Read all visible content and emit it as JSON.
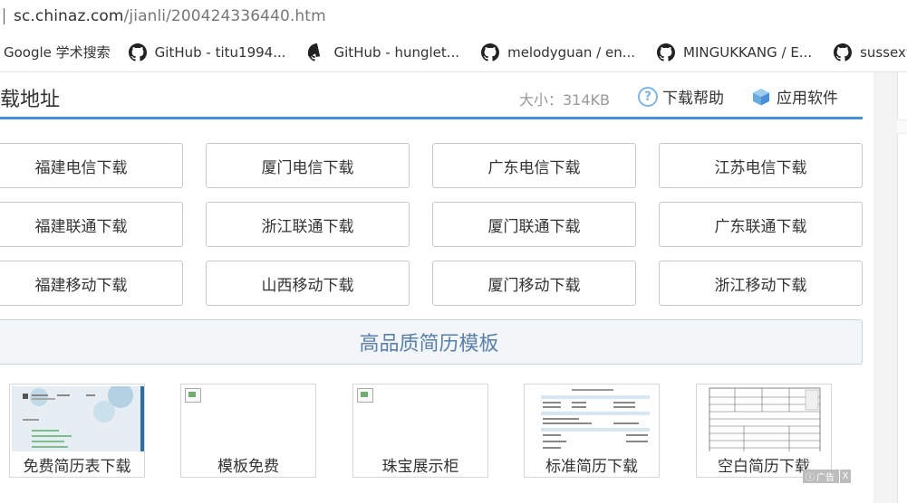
{
  "address_bar": {
    "url_host": "sc.chinaz.com",
    "url_path": "/jianli/200424336440.htm"
  },
  "bookmarks": [
    {
      "label": "Google 学术搜索",
      "icon": "none"
    },
    {
      "label": "GitHub - titu1994...",
      "icon": "github-icon"
    },
    {
      "label": "GitHub - hunglet...",
      "icon": "github-icon"
    },
    {
      "label": "melodyguan / en...",
      "icon": "github-icon"
    },
    {
      "label": "MINGUKKANG / E...",
      "icon": "github-icon"
    },
    {
      "label": "sussexwe",
      "icon": "github-icon"
    }
  ],
  "header": {
    "title": "载地址",
    "size": "大小：314KB",
    "help_label": "下载帮助",
    "apps_label": "应用软件"
  },
  "downloads": [
    [
      "福建电信下载",
      "厦门电信下载",
      "广东电信下载",
      "江苏电信下载"
    ],
    [
      "福建联通下载",
      "浙江联通下载",
      "厦门联通下载",
      "广东联通下载"
    ],
    [
      "福建移动下载",
      "山西移动下载",
      "厦门移动下载",
      "浙江移动下载"
    ]
  ],
  "banner": {
    "label": "高品质简历模板"
  },
  "thumbnails": [
    {
      "caption": "免费简历表下载"
    },
    {
      "caption": "模板免费"
    },
    {
      "caption": "珠宝展示柜"
    },
    {
      "caption": "标准简历下载"
    },
    {
      "caption": "空白简历下载"
    }
  ],
  "ad_badge": {
    "label": "广告",
    "close": "X"
  },
  "colors": {
    "accent": "#4a90d9",
    "banner_text": "#5a7fa8"
  }
}
